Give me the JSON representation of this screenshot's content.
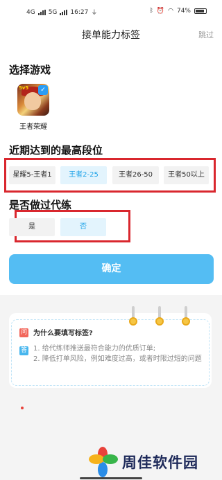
{
  "status_bar": {
    "signal1": "4G",
    "signal2": "5G",
    "time": "16:27",
    "speed": "0.00\nKB/s",
    "battery": "74%"
  },
  "header": {
    "title": "接单能力标签",
    "skip": "跳过"
  },
  "game_section": {
    "title": "选择游戏",
    "game_name": "王者荣耀",
    "badge": "5v5"
  },
  "rank_section": {
    "title": "近期达到的最高段位",
    "options": [
      "星耀5-王者1",
      "王者2-25",
      "王者26-50",
      "王者50以上"
    ],
    "selected_index": 1
  },
  "booster_section": {
    "title": "是否做过代练",
    "options": [
      "是",
      "否"
    ],
    "selected_index": 1
  },
  "confirm_label": "确定",
  "faq": {
    "q_badge": "问",
    "question": "为什么要填写标签?",
    "a_badge": "答",
    "answer_line1": "1. 给代练师推送最符合能力的优质订单;",
    "answer_line2": "2. 降低打单风险，例如难度过高，或者时限过短的问题"
  },
  "watermark": "周佳软件园",
  "colors": {
    "accent": "#54bdf3",
    "selected_text": "#1fa3e8",
    "selected_bg": "#e3f4fd",
    "highlight_box": "#d9272e"
  }
}
